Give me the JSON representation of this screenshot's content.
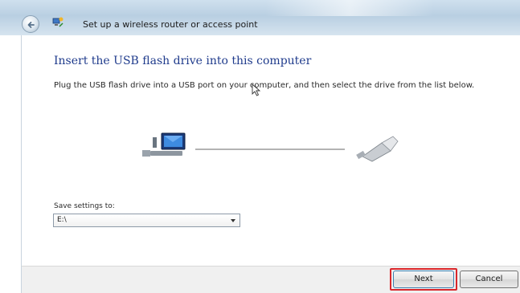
{
  "window": {
    "title": "Set up a wireless router or access point",
    "back_icon": "back-arrow-icon",
    "wizard_icon": "network-setup-icon"
  },
  "page": {
    "heading": "Insert the USB flash drive into this computer",
    "instructions": "Plug the USB flash drive into a USB port on your computer, and then select the drive from the list below."
  },
  "graphic": {
    "computer_icon": "computer-icon",
    "usb_icon": "usb-flash-drive-icon"
  },
  "save_settings": {
    "label": "Save settings to:",
    "selected": "E:\\"
  },
  "buttons": {
    "next": "Next",
    "cancel": "Cancel"
  },
  "colors": {
    "heading": "#1f3b8c",
    "highlight": "#d9262b"
  }
}
